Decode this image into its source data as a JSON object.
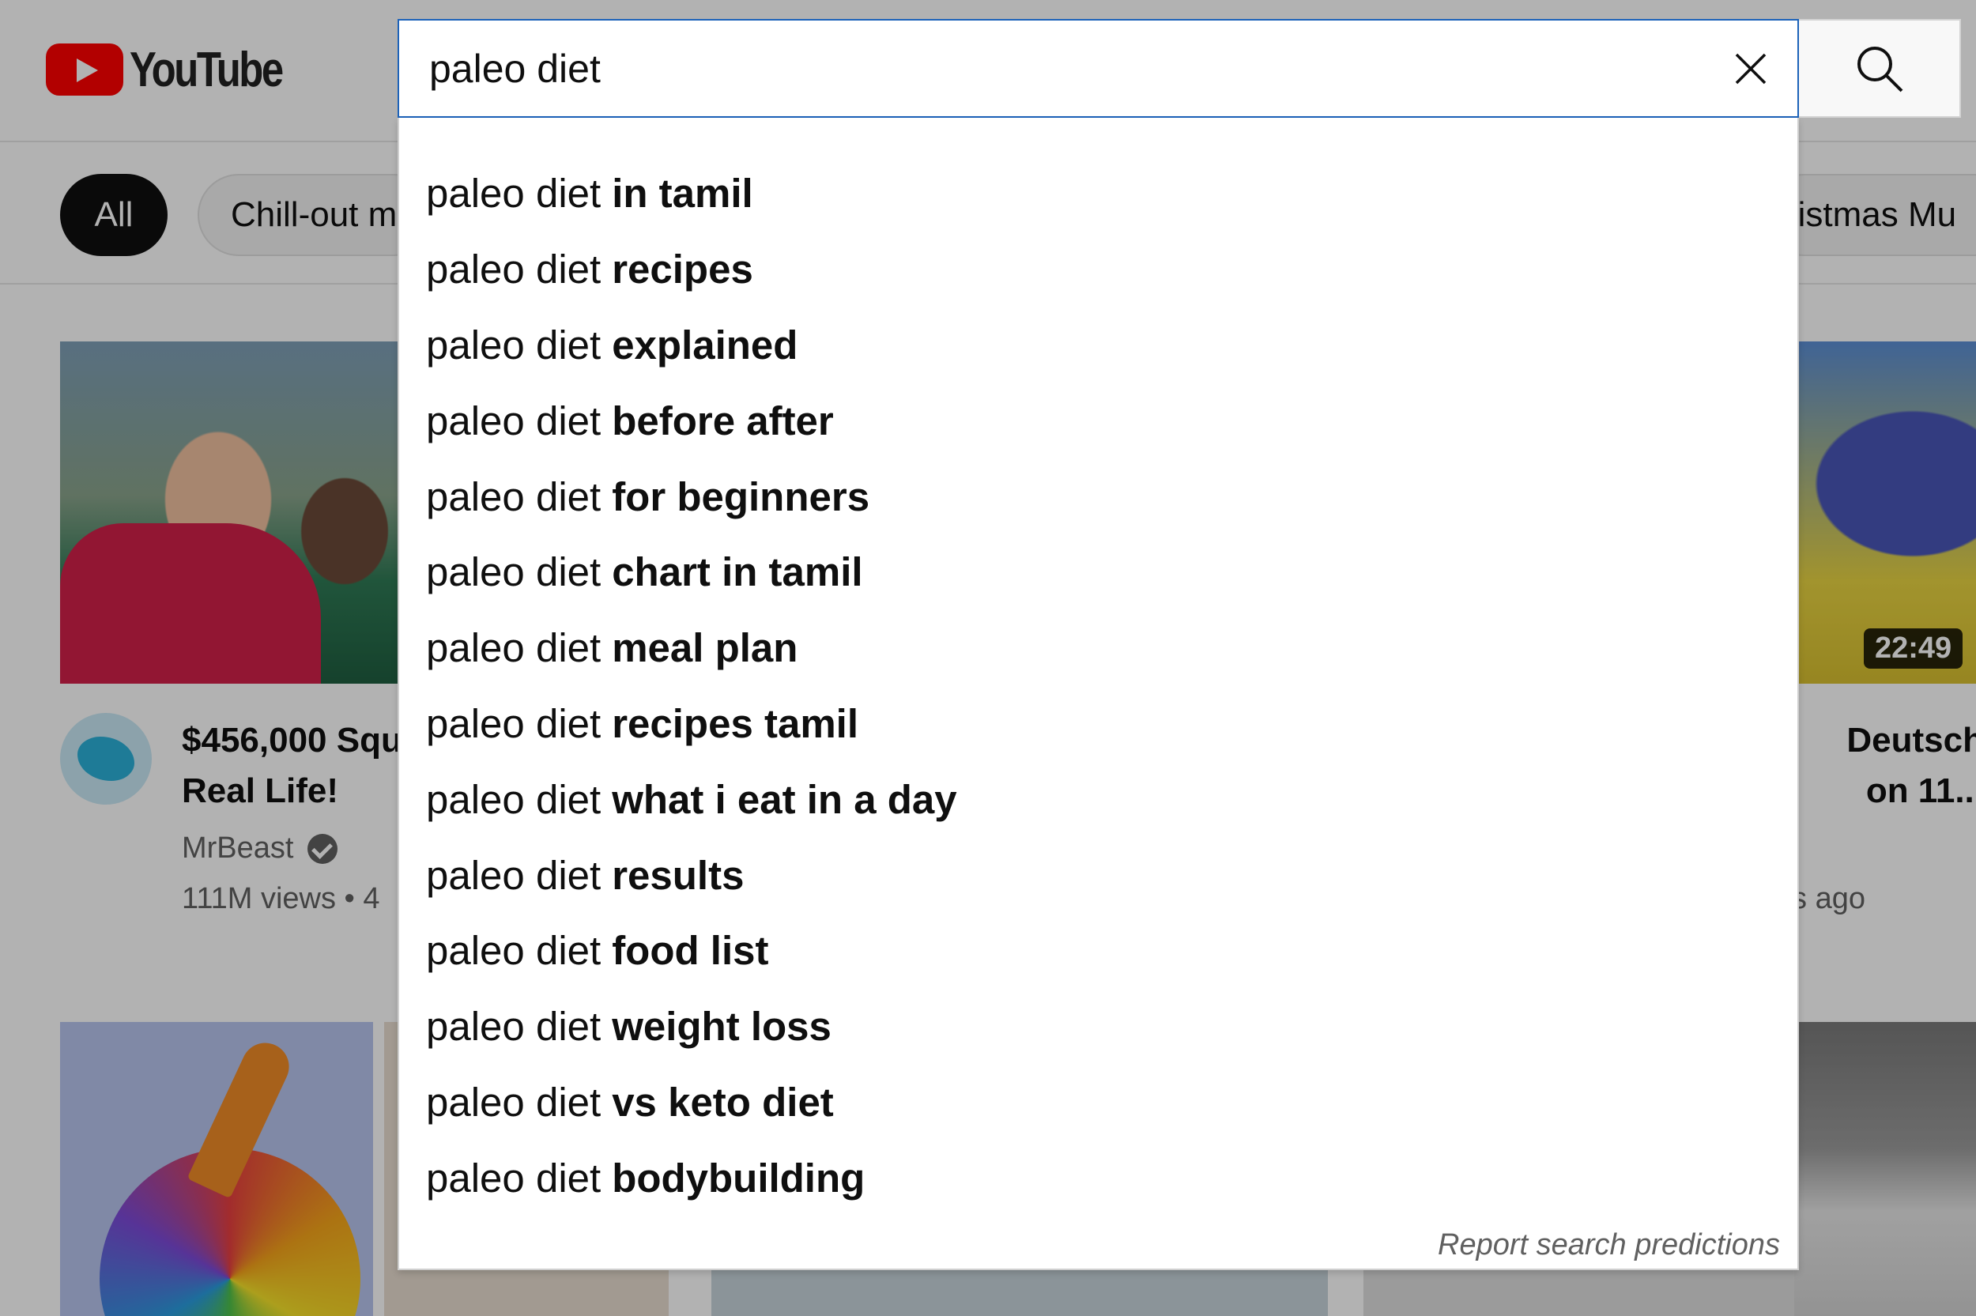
{
  "brand": {
    "name": "YouTube",
    "logo_icon": "youtube-play-icon",
    "logo_color": "#ff0000"
  },
  "search": {
    "value": "paleo diet",
    "clear_icon": "close-icon",
    "search_icon": "search-icon",
    "accent": "#1c62b9"
  },
  "chips": {
    "items": [
      {
        "label": "All",
        "active": true
      },
      {
        "label": "Chill-out m",
        "active": false
      },
      {
        "label": "ristmas Mu",
        "active": false
      }
    ]
  },
  "suggestions": {
    "typed": "paleo diet",
    "items": [
      "in tamil",
      "recipes",
      "explained",
      "before after",
      "for beginners",
      "chart in tamil",
      "meal plan",
      "recipes tamil",
      "what i eat in a day",
      "results",
      "food list",
      "weight loss",
      "vs keto diet",
      "bodybuilding"
    ],
    "report_label": "Report search predictions"
  },
  "videos": {
    "first": {
      "title": "$456,000 Squ",
      "title_line2": "Real Life!",
      "channel": "MrBeast",
      "meta": "111M views • 4"
    },
    "right": {
      "title_line1": "Deutsch",
      "title_line2": "on 11...",
      "meta": "s ago",
      "duration": "22:49"
    }
  }
}
